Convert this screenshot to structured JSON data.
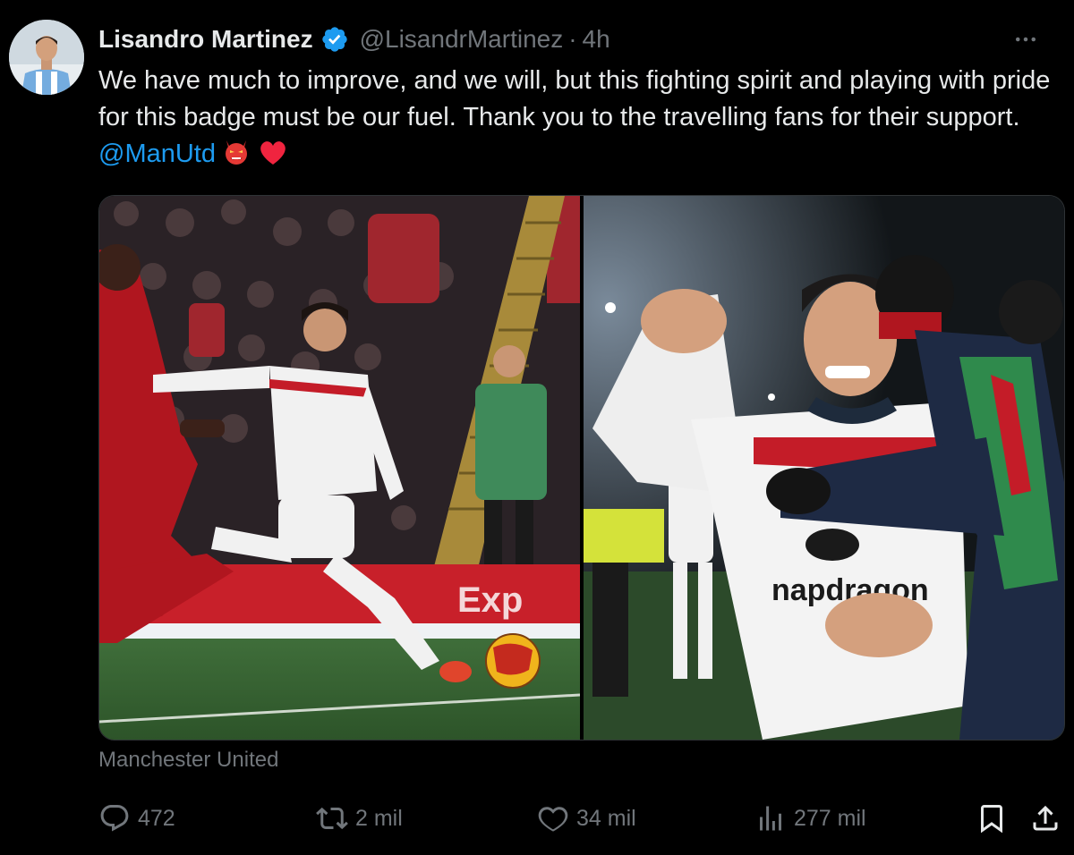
{
  "author": {
    "name": "Lisandro Martinez",
    "handle": "@LisandrMartinez",
    "separator": "·",
    "time": "4h",
    "avatar_icon": "profile-avatar",
    "verified_icon": "verified-badge-icon"
  },
  "tweet": {
    "text_part1": "We have much to improve, and we will, but this fighting spirit and playing with pride for this badge must be our fuel. Thank you to the travelling fans for their support. ",
    "mention": "@ManUtd",
    "emojis": [
      "red-devil-emoji",
      "red-heart-emoji"
    ]
  },
  "media": {
    "images": [
      {
        "name": "player-shooting-photo"
      },
      {
        "name": "player-celebrating-photo"
      }
    ]
  },
  "attribution": "Manchester United",
  "actions": {
    "reply": {
      "icon": "reply-icon",
      "count": "472"
    },
    "retweet": {
      "icon": "retweet-icon",
      "count": "2 mil"
    },
    "like": {
      "icon": "heart-icon",
      "count": "34 mil"
    },
    "views": {
      "icon": "views-icon",
      "count": "277 mil"
    },
    "bookmark": {
      "icon": "bookmark-icon"
    },
    "share": {
      "icon": "share-icon"
    }
  },
  "colors": {
    "background": "#000000",
    "text": "#e7e9ea",
    "muted": "#71767b",
    "accent": "#1d9bf0"
  }
}
